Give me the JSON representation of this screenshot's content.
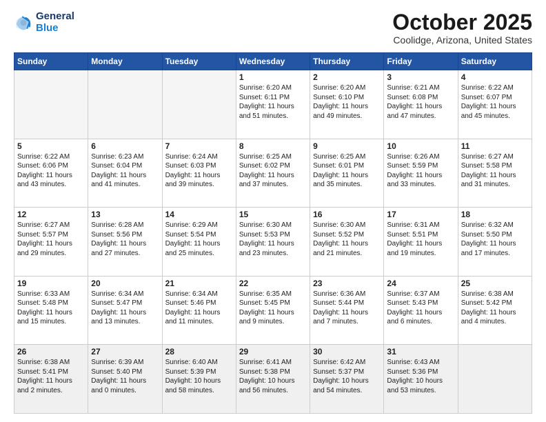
{
  "logo": {
    "line1": "General",
    "line2": "Blue"
  },
  "header": {
    "month": "October 2025",
    "location": "Coolidge, Arizona, United States"
  },
  "days_of_week": [
    "Sunday",
    "Monday",
    "Tuesday",
    "Wednesday",
    "Thursday",
    "Friday",
    "Saturday"
  ],
  "weeks": [
    [
      {
        "day": "",
        "content": ""
      },
      {
        "day": "",
        "content": ""
      },
      {
        "day": "",
        "content": ""
      },
      {
        "day": "1",
        "content": "Sunrise: 6:20 AM\nSunset: 6:11 PM\nDaylight: 11 hours\nand 51 minutes."
      },
      {
        "day": "2",
        "content": "Sunrise: 6:20 AM\nSunset: 6:10 PM\nDaylight: 11 hours\nand 49 minutes."
      },
      {
        "day": "3",
        "content": "Sunrise: 6:21 AM\nSunset: 6:08 PM\nDaylight: 11 hours\nand 47 minutes."
      },
      {
        "day": "4",
        "content": "Sunrise: 6:22 AM\nSunset: 6:07 PM\nDaylight: 11 hours\nand 45 minutes."
      }
    ],
    [
      {
        "day": "5",
        "content": "Sunrise: 6:22 AM\nSunset: 6:06 PM\nDaylight: 11 hours\nand 43 minutes."
      },
      {
        "day": "6",
        "content": "Sunrise: 6:23 AM\nSunset: 6:04 PM\nDaylight: 11 hours\nand 41 minutes."
      },
      {
        "day": "7",
        "content": "Sunrise: 6:24 AM\nSunset: 6:03 PM\nDaylight: 11 hours\nand 39 minutes."
      },
      {
        "day": "8",
        "content": "Sunrise: 6:25 AM\nSunset: 6:02 PM\nDaylight: 11 hours\nand 37 minutes."
      },
      {
        "day": "9",
        "content": "Sunrise: 6:25 AM\nSunset: 6:01 PM\nDaylight: 11 hours\nand 35 minutes."
      },
      {
        "day": "10",
        "content": "Sunrise: 6:26 AM\nSunset: 5:59 PM\nDaylight: 11 hours\nand 33 minutes."
      },
      {
        "day": "11",
        "content": "Sunrise: 6:27 AM\nSunset: 5:58 PM\nDaylight: 11 hours\nand 31 minutes."
      }
    ],
    [
      {
        "day": "12",
        "content": "Sunrise: 6:27 AM\nSunset: 5:57 PM\nDaylight: 11 hours\nand 29 minutes."
      },
      {
        "day": "13",
        "content": "Sunrise: 6:28 AM\nSunset: 5:56 PM\nDaylight: 11 hours\nand 27 minutes."
      },
      {
        "day": "14",
        "content": "Sunrise: 6:29 AM\nSunset: 5:54 PM\nDaylight: 11 hours\nand 25 minutes."
      },
      {
        "day": "15",
        "content": "Sunrise: 6:30 AM\nSunset: 5:53 PM\nDaylight: 11 hours\nand 23 minutes."
      },
      {
        "day": "16",
        "content": "Sunrise: 6:30 AM\nSunset: 5:52 PM\nDaylight: 11 hours\nand 21 minutes."
      },
      {
        "day": "17",
        "content": "Sunrise: 6:31 AM\nSunset: 5:51 PM\nDaylight: 11 hours\nand 19 minutes."
      },
      {
        "day": "18",
        "content": "Sunrise: 6:32 AM\nSunset: 5:50 PM\nDaylight: 11 hours\nand 17 minutes."
      }
    ],
    [
      {
        "day": "19",
        "content": "Sunrise: 6:33 AM\nSunset: 5:48 PM\nDaylight: 11 hours\nand 15 minutes."
      },
      {
        "day": "20",
        "content": "Sunrise: 6:34 AM\nSunset: 5:47 PM\nDaylight: 11 hours\nand 13 minutes."
      },
      {
        "day": "21",
        "content": "Sunrise: 6:34 AM\nSunset: 5:46 PM\nDaylight: 11 hours\nand 11 minutes."
      },
      {
        "day": "22",
        "content": "Sunrise: 6:35 AM\nSunset: 5:45 PM\nDaylight: 11 hours\nand 9 minutes."
      },
      {
        "day": "23",
        "content": "Sunrise: 6:36 AM\nSunset: 5:44 PM\nDaylight: 11 hours\nand 7 minutes."
      },
      {
        "day": "24",
        "content": "Sunrise: 6:37 AM\nSunset: 5:43 PM\nDaylight: 11 hours\nand 6 minutes."
      },
      {
        "day": "25",
        "content": "Sunrise: 6:38 AM\nSunset: 5:42 PM\nDaylight: 11 hours\nand 4 minutes."
      }
    ],
    [
      {
        "day": "26",
        "content": "Sunrise: 6:38 AM\nSunset: 5:41 PM\nDaylight: 11 hours\nand 2 minutes."
      },
      {
        "day": "27",
        "content": "Sunrise: 6:39 AM\nSunset: 5:40 PM\nDaylight: 11 hours\nand 0 minutes."
      },
      {
        "day": "28",
        "content": "Sunrise: 6:40 AM\nSunset: 5:39 PM\nDaylight: 10 hours\nand 58 minutes."
      },
      {
        "day": "29",
        "content": "Sunrise: 6:41 AM\nSunset: 5:38 PM\nDaylight: 10 hours\nand 56 minutes."
      },
      {
        "day": "30",
        "content": "Sunrise: 6:42 AM\nSunset: 5:37 PM\nDaylight: 10 hours\nand 54 minutes."
      },
      {
        "day": "31",
        "content": "Sunrise: 6:43 AM\nSunset: 5:36 PM\nDaylight: 10 hours\nand 53 minutes."
      },
      {
        "day": "",
        "content": ""
      }
    ]
  ]
}
